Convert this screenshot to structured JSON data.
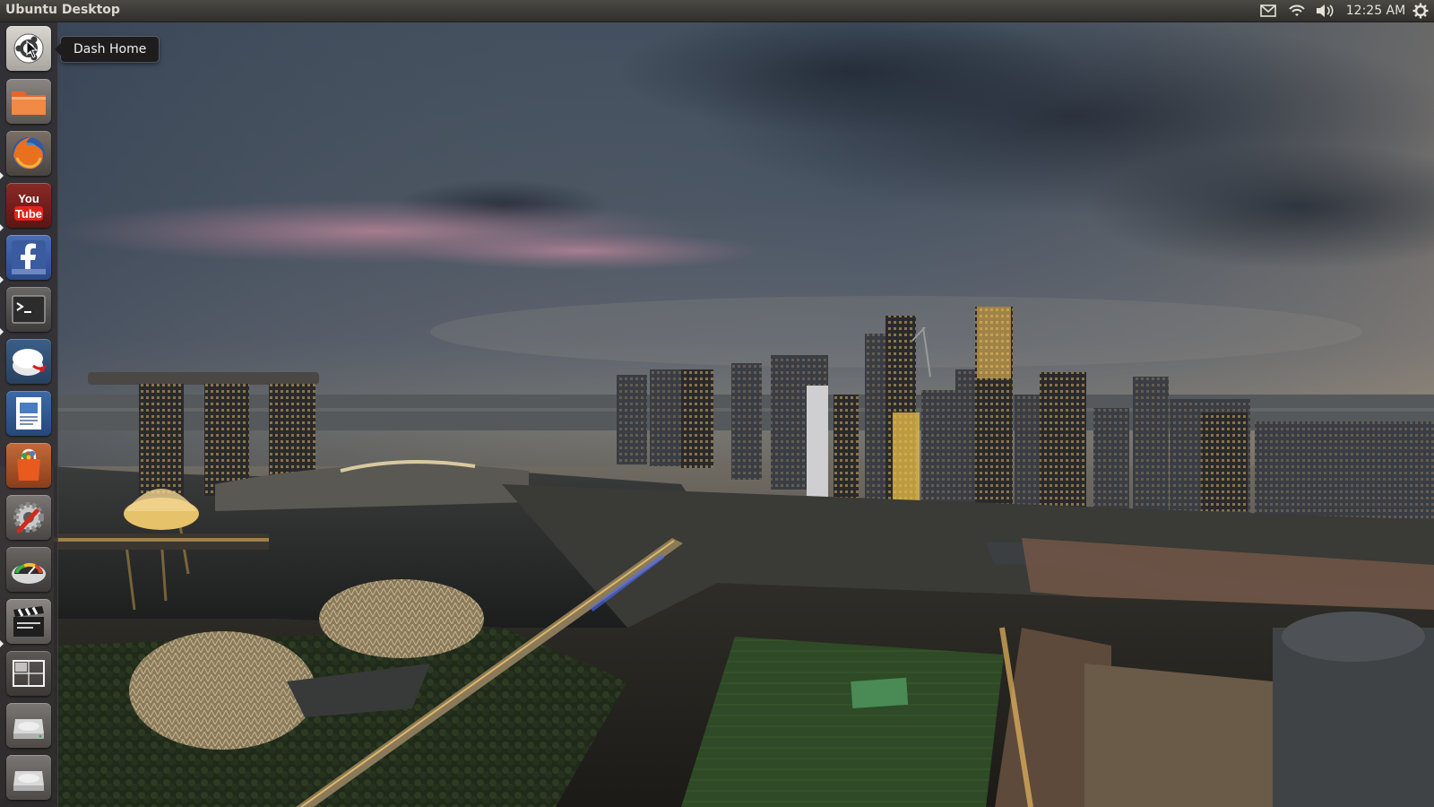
{
  "panel": {
    "title": "Ubuntu Desktop",
    "clock": "12:25 AM",
    "indicators": [
      "mail-icon",
      "network-wifi-icon",
      "volume-icon",
      "gear-icon"
    ]
  },
  "tooltip": {
    "text": "Dash Home"
  },
  "launcher": {
    "items": [
      {
        "icon": "dash-home-icon",
        "running": false
      },
      {
        "icon": "home-folder-icon",
        "running": false
      },
      {
        "icon": "firefox-icon",
        "running": true
      },
      {
        "icon": "youtube-icon",
        "running": true
      },
      {
        "icon": "facebook-icon",
        "running": true
      },
      {
        "icon": "terminal-icon",
        "running": true
      },
      {
        "icon": "disk-utility-icon",
        "running": false
      },
      {
        "icon": "text-editor-icon",
        "running": false
      },
      {
        "icon": "software-center-icon",
        "running": false
      },
      {
        "icon": "system-settings-icon",
        "running": false
      },
      {
        "icon": "system-monitor-icon",
        "running": false
      },
      {
        "icon": "video-editor-icon",
        "running": true
      },
      {
        "icon": "workspace-switcher-icon",
        "running": false
      },
      {
        "icon": "drive-icon",
        "running": false
      },
      {
        "icon": "drive-icon",
        "running": false
      }
    ]
  },
  "colors": {
    "panel": "#3c3b37",
    "launcher": "#302c2e",
    "accent": "#dd4814"
  }
}
